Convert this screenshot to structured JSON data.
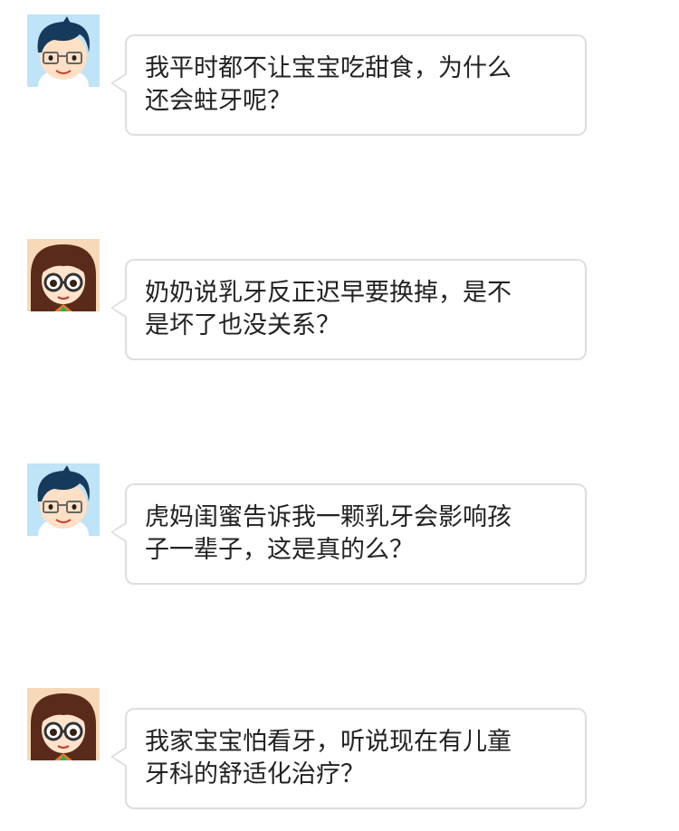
{
  "messages": [
    {
      "avatar": "boy-avatar",
      "lines": [
        "我平时都不让宝宝吃甜食，为什么",
        "还会蛀牙呢？"
      ]
    },
    {
      "avatar": "girl-avatar",
      "lines": [
        "奶奶说乳牙反正迟早要换掉，是不",
        "是坏了也没关系？"
      ]
    },
    {
      "avatar": "boy-avatar",
      "lines": [
        "虎妈闺蜜告诉我一颗乳牙会影响孩",
        "子一辈子，这是真的么？"
      ]
    },
    {
      "avatar": "girl-avatar",
      "lines": [
        "我家宝宝怕看牙，听说现在有儿童",
        "牙科的舒适化治疗？"
      ]
    }
  ],
  "colors": {
    "bubble_border": "#dedede",
    "text": "#222222",
    "boy_background": "#bfe3f7",
    "girl_background": "#f6d9b8"
  }
}
